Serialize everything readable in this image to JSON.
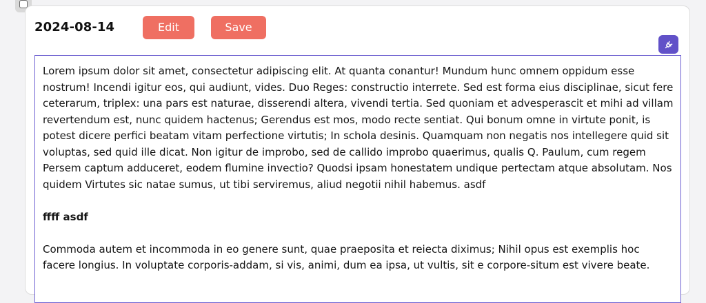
{
  "entry": {
    "date": "2024-08-14",
    "edit_label": "Edit",
    "save_label": "Save",
    "plugin_icon": "plug-icon",
    "accent_color": "#6151c8",
    "button_color": "#ef6f62"
  },
  "editor": {
    "paragraphs": [
      "Lorem ipsum dolor sit amet, consectetur adipiscing elit. At quanta conantur! Mundum hunc omnem oppidum esse nostrum! Incendi igitur eos, qui audiunt, vides. Duo Reges: constructio interrete. Sed est forma eius disciplinae, sicut fere ceterarum, triplex: una pars est naturae, disserendi altera, vivendi tertia. Sed quoniam et advesperascit et mihi ad villam revertendum est, nunc quidem hactenus; Gerendus est mos, modo recte sentiat. Qui bonum omne in virtute ponit, is potest dicere perfici beatam vitam perfectione virtutis; In schola desinis. Quamquam non negatis nos intellegere quid sit voluptas, sed quid ille dicat. Non igitur de improbo, sed de callido improbo quaerimus, qualis Q. Paulum, cum regem Persem captum adduceret, eodem flumine invectio? Quodsi ipsam honestatem undique pertectam atque absolutam. Nos quidem Virtutes sic natae sumus, ut tibi serviremus, aliud negotii nihil habemus. asdf",
      "ffff asdf",
      "Commoda autem et incommoda in eo genere sunt, quae praeposita et reiecta diximus; Nihil opus est exemplis hoc facere longius. In voluptate corporis-addam, si vis, animi, dum ea ipsa, ut vultis, sit e corpore-situm est vivere beate."
    ]
  }
}
